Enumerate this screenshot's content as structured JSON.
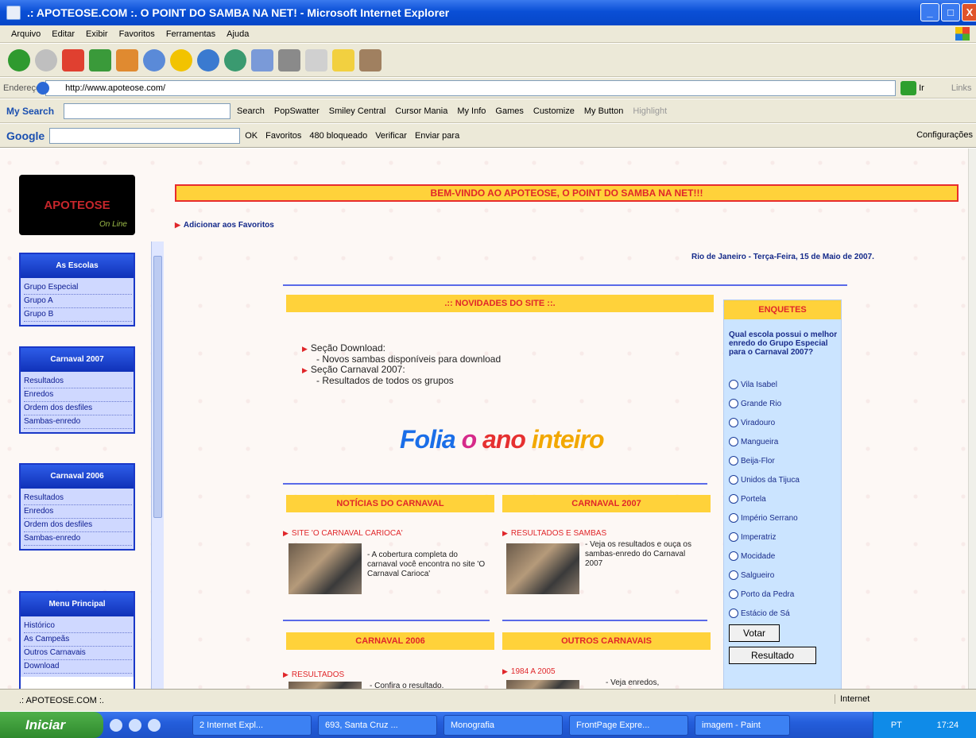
{
  "window": {
    "title": ".: APOTEOSE.COM :. O POINT DO SAMBA NA NET! - Microsoft Internet Explorer",
    "min": "_",
    "max": "□",
    "close": "X"
  },
  "menu": [
    "Arquivo",
    "Editar",
    "Exibir",
    "Favoritos",
    "Ferramentas",
    "Ajuda"
  ],
  "address": {
    "label": "Endereço",
    "url": "http://www.apoteose.com/",
    "go": "Ir",
    "links": "Links"
  },
  "mysearch": {
    "logo": "My Search",
    "items": [
      "Search",
      "PopSwatter",
      "Smiley Central",
      "Cursor Mania",
      "My Info",
      "Games",
      "Customize",
      "My Button",
      "Highlight"
    ]
  },
  "googlebar": {
    "logo": "Google",
    "items": [
      "OK",
      "Favoritos",
      "480 bloqueado",
      "Verificar",
      "Enviar para"
    ],
    "settings": "Configurações"
  },
  "site": {
    "logo": "APOTEOSE",
    "logo_sub": "On Line",
    "banner": "BEM-VINDO AO APOTEOSE, O POINT DO SAMBA NA NET!!!",
    "favorites_link": "Adicionar aos Favoritos",
    "date": "Rio de Janeiro - Terça-Feira, 15 de Maio de 2007.",
    "nav": [
      {
        "title": "As Escolas",
        "items": [
          "Grupo Especial",
          "Grupo A",
          "Grupo B"
        ]
      },
      {
        "title": "Carnaval 2007",
        "items": [
          "Resultados",
          "Enredos",
          "Ordem dos desfiles",
          "Sambas-enredo"
        ]
      },
      {
        "title": "Carnaval 2006",
        "items": [
          "Resultados",
          "Enredos",
          "Ordem dos desfiles",
          "Sambas-enredo"
        ]
      },
      {
        "title": "Menu Principal",
        "items": [
          "Histórico",
          "As Campeãs",
          "Outros Carnavais",
          "Download"
        ]
      }
    ],
    "novidades": {
      "title": ".:: NOVIDADES DO SITE ::.",
      "items": [
        {
          "label": "Seção Download:",
          "sub": "- Novos sambas disponíveis para download"
        },
        {
          "label": "Seção Carnaval 2007:",
          "sub": "- Resultados de todos os grupos"
        }
      ]
    },
    "folia": [
      "Folia",
      "o",
      "ano",
      "inteiro"
    ],
    "sections": {
      "noticias": {
        "title": "NOTÍCIAS DO CARNAVAL",
        "link": "SITE 'O CARNAVAL CARIOCA'",
        "text": "- A cobertura completa do carnaval você encontra no site 'O Carnaval Carioca'"
      },
      "carnaval2007": {
        "title": "CARNAVAL 2007",
        "link": "RESULTADOS E SAMBAS",
        "text": "- Veja os resultados e ouça os sambas-enredo do Carnaval 2007"
      },
      "carnaval2006": {
        "title": "CARNAVAL 2006",
        "link": "RESULTADOS",
        "text": "- Confira o resultado."
      },
      "outros": {
        "title": "OUTROS CARNAVAIS",
        "link": "1984 A 2005",
        "text": "- Veja enredos,"
      }
    },
    "poll": {
      "title": "ENQUETES",
      "question": "Qual escola possui o melhor enredo do Grupo Especial para o Carnaval 2007?",
      "options": [
        "Vila Isabel",
        "Grande Rio",
        "Viradouro",
        "Mangueira",
        "Beija-Flor",
        "Unidos da Tijuca",
        "Portela",
        "Império Serrano",
        "Imperatriz",
        "Mocidade",
        "Salgueiro",
        "Porto da Pedra",
        "Estácio de Sá"
      ],
      "vote": "Votar",
      "result": "Resultado"
    }
  },
  "status": {
    "text": ".: APOTEOSE.COM :.",
    "zone": "Internet"
  },
  "taskbar": {
    "start": "Iniciar",
    "tasks": [
      "2 Internet Expl...",
      "693, Santa Cruz ...",
      "Monografia",
      "FrontPage Expre...",
      "imagem - Paint"
    ],
    "lang": "PT",
    "clock": "17:24"
  }
}
